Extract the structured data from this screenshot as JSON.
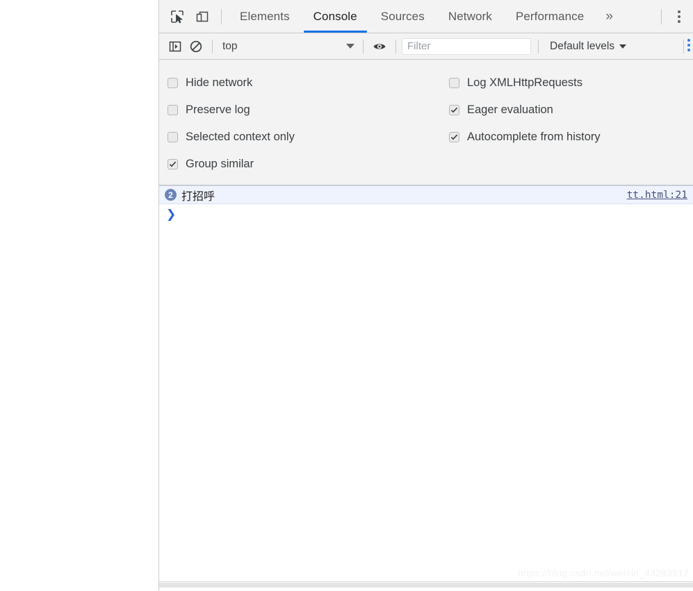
{
  "devtools": {
    "tabbar": {
      "inspect_icon": "inspect-cursor-icon",
      "device_toggle_icon": "device-toolbar-icon",
      "tabs": [
        {
          "label": "Elements",
          "active": false
        },
        {
          "label": "Console",
          "active": true
        },
        {
          "label": "Sources",
          "active": false
        },
        {
          "label": "Network",
          "active": false
        },
        {
          "label": "Performance",
          "active": false
        }
      ],
      "more_tabs_glyph": "»",
      "more_tabs_icon": "more-tabs-chevron-icon",
      "menu_icon": "kebab-menu-icon",
      "active_underline_color": "#1a73e8"
    },
    "toolbar": {
      "sidebar_toggle_icon": "console-sidebar-toggle-icon",
      "clear_console_icon": "clear-console-icon",
      "context": {
        "value": "top",
        "caret_icon": "chevron-down-icon"
      },
      "eye_icon": "live-expression-eye-icon",
      "filter": {
        "placeholder": "Filter",
        "value": ""
      },
      "levels": {
        "label": "Default levels",
        "caret_icon": "chevron-down-icon"
      },
      "overflow_icon": "console-settings-kebab-icon"
    },
    "settings": {
      "left_column": [
        {
          "label": "Hide network",
          "checked": false
        },
        {
          "label": "Preserve log",
          "checked": false
        },
        {
          "label": "Selected context only",
          "checked": false
        },
        {
          "label": "Group similar",
          "checked": true
        }
      ],
      "right_column": [
        {
          "label": "Log XMLHttpRequests",
          "checked": false
        },
        {
          "label": "Eager evaluation",
          "checked": true
        },
        {
          "label": "Autocomplete from history",
          "checked": true
        }
      ]
    },
    "console": {
      "messages": [
        {
          "count": "2",
          "text": "打招呼",
          "source": "tt.html:21",
          "badge_color": "#6b83b8",
          "row_background": "#eff3fd"
        }
      ],
      "prompt_glyph": "❯",
      "prompt_color": "#2a62d6"
    },
    "watermark": "https://blog.csdn.net/weixin_43283917"
  }
}
